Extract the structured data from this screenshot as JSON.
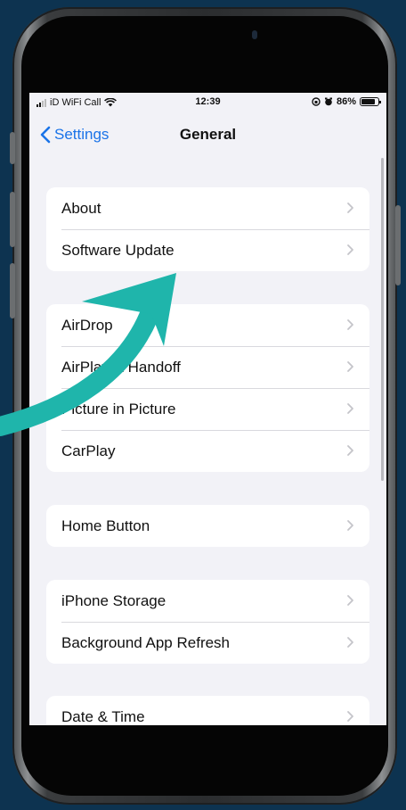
{
  "status_bar": {
    "carrier": "iD WiFi Call",
    "time": "12:39",
    "battery": "86%",
    "battery_level": 0.86
  },
  "nav": {
    "back_label": "Settings",
    "title": "General"
  },
  "groups": [
    {
      "items": [
        "About",
        "Software Update"
      ]
    },
    {
      "items": [
        "AirDrop",
        "AirPlay & Handoff",
        "Picture in Picture",
        "CarPlay"
      ]
    },
    {
      "items": [
        "Home Button"
      ]
    },
    {
      "items": [
        "iPhone Storage",
        "Background App Refresh"
      ]
    },
    {
      "items": [
        "Date & Time"
      ]
    }
  ],
  "colors": {
    "background": "#0d3350",
    "arrow": "#1fb5ab",
    "accent": "#1a73e8"
  }
}
